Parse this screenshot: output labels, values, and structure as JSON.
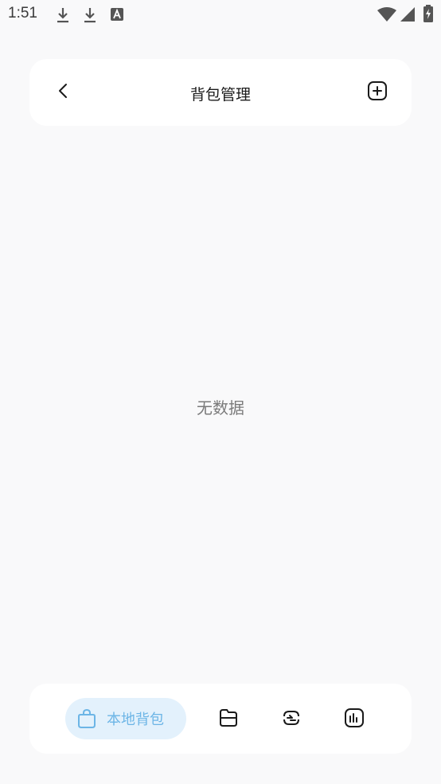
{
  "status_bar": {
    "time": "1:51",
    "icons": [
      "download-icon",
      "download-icon",
      "font-icon",
      "wifi-icon",
      "signal-icon",
      "battery-charging-icon"
    ]
  },
  "header": {
    "title": "背包管理",
    "back_icon": "chevron-left-icon",
    "add_icon": "add-square-icon"
  },
  "main": {
    "empty_text": "无数据"
  },
  "bottom_nav": {
    "active_label": "本地背包",
    "accent_color": "#6cb5e6",
    "active_bg": "#e3f1fc",
    "items": [
      {
        "name": "local-backpack",
        "icon": "bag-icon"
      },
      {
        "name": "folder",
        "icon": "folder-icon"
      },
      {
        "name": "sync",
        "icon": "sync-icon"
      },
      {
        "name": "stats",
        "icon": "chart-icon"
      }
    ]
  }
}
